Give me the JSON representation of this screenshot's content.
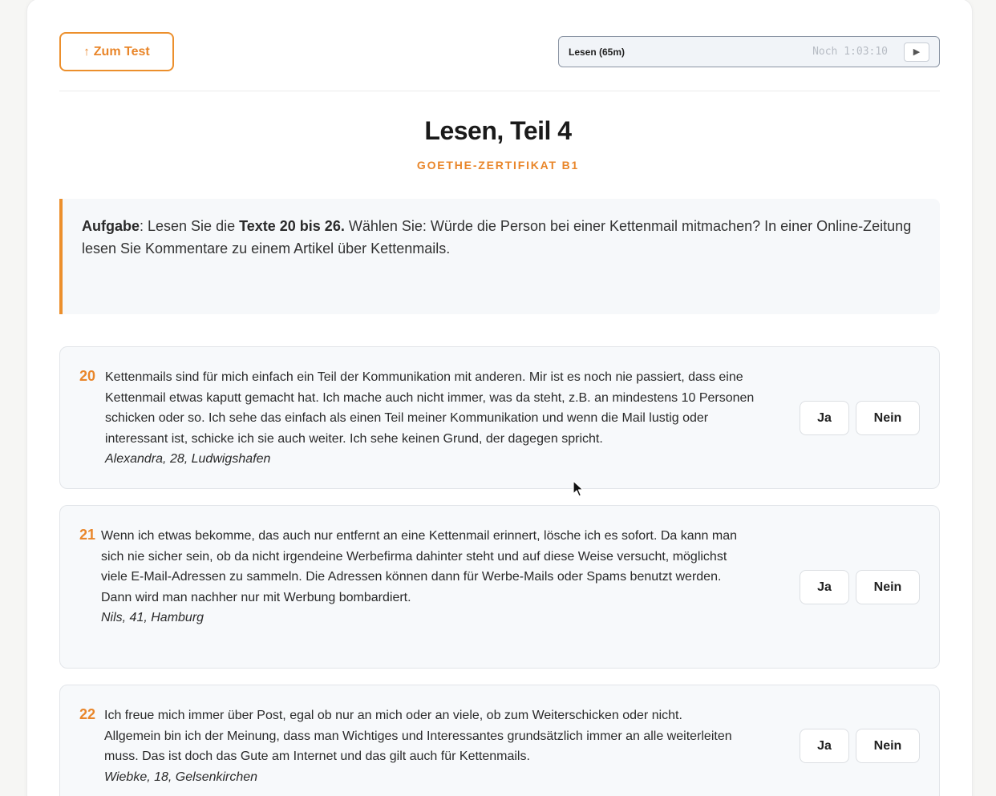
{
  "header": {
    "back_label": "Zum Test",
    "timer_label": "Lesen (65m)",
    "timer_remaining": "Noch 1:03:10"
  },
  "title": "Lesen, Teil 4",
  "subtitle": "GOETHE-ZERTIFIKAT B1",
  "task": {
    "label": "Aufgabe",
    "p1": ": Lesen Sie die ",
    "texts": "Texte 20 bis 26.",
    "p2": " Wählen Sie: Würde die Person bei einer Kettenmail mitmachen? In einer Online-Zeitung lesen Sie Kommentare zu einem Artikel über Kettenmails."
  },
  "answers": {
    "yes": "Ja",
    "no": "Nein"
  },
  "items": [
    {
      "number": "20",
      "text": "Kettenmails sind für mich einfach ein Teil der Kommunikation mit anderen. Mir ist es noch nie passiert, dass eine Kettenmail etwas kaputt gemacht hat. Ich mache auch nicht immer, was da steht, z.B. an mindestens 10 Personen schicken oder so. Ich sehe das einfach als einen Teil meiner Kommunikation und wenn die Mail lustig oder interessant ist, schicke ich sie auch weiter. Ich sehe keinen Grund, der dagegen spricht.",
      "author": "Alexandra, 28, Ludwigshafen"
    },
    {
      "number": "21",
      "text": "Wenn ich etwas bekomme, das auch nur entfernt an eine Kettenmail erinnert, lösche ich es sofort. Da kann man sich nie sicher sein, ob da nicht irgendeine Werbefirma dahinter steht und auf diese Weise versucht, möglichst viele E-Mail-Adressen zu sammeln. Die Adressen können dann für Werbe-Mails oder Spams benutzt werden. Dann wird man nachher nur mit Werbung bombardiert.",
      "author": "Nils, 41, Hamburg"
    },
    {
      "number": "22",
      "text": "Ich freue mich immer über Post, egal ob nur an mich oder an viele, ob zum Weiterschicken oder nicht. Allgemein bin ich der Meinung, dass man Wichtiges und Interessantes grundsätzlich immer an alle weiterleiten muss. Das ist doch das Gute am Internet und das gilt auch für Kettenmails.",
      "author": "Wiebke, 18, Gelsenkirchen"
    }
  ]
}
